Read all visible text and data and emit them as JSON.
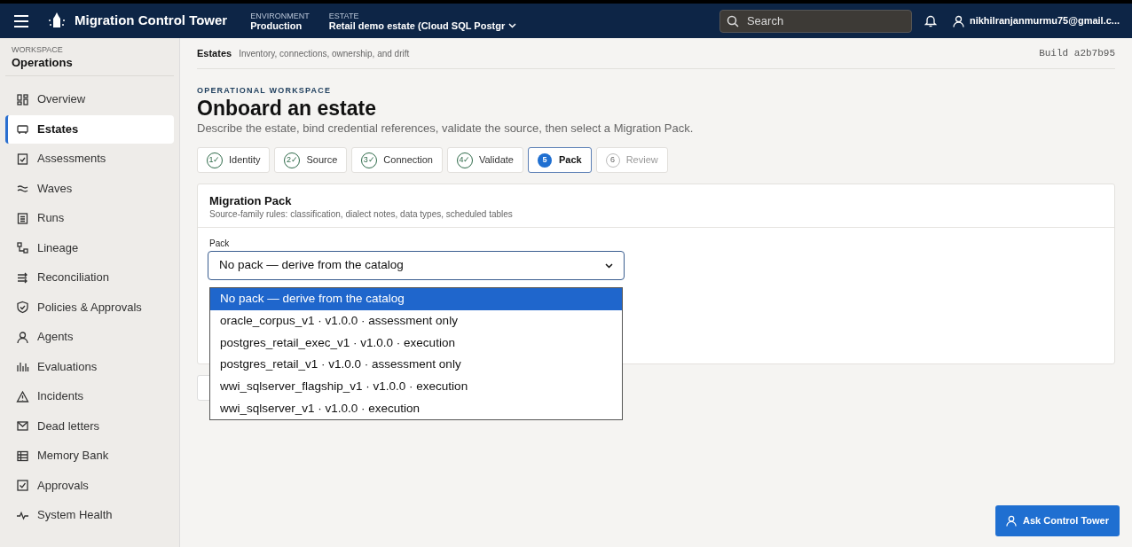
{
  "topbar": {
    "title": "Migration Control Tower",
    "environment": {
      "label": "ENVIRONMENT",
      "value": "Production"
    },
    "estate": {
      "label": "ESTATE",
      "value": "Retail demo estate (Cloud SQL Postgr"
    },
    "search": {
      "placeholder": "Search"
    },
    "user": "nikhilranjanmurmu75@gmail.c..."
  },
  "sidebar": {
    "workspace_label": "WORKSPACE",
    "workspace": "Operations",
    "items": [
      {
        "label": "Overview",
        "selected": false
      },
      {
        "label": "Estates",
        "selected": true
      },
      {
        "label": "Assessments",
        "selected": false
      },
      {
        "label": "Waves",
        "selected": false
      },
      {
        "label": "Runs",
        "selected": false
      },
      {
        "label": "Lineage",
        "selected": false
      },
      {
        "label": "Reconciliation",
        "selected": false
      },
      {
        "label": "Policies & Approvals",
        "selected": false
      },
      {
        "label": "Agents",
        "selected": false
      },
      {
        "label": "Evaluations",
        "selected": false
      },
      {
        "label": "Incidents",
        "selected": false
      },
      {
        "label": "Dead letters",
        "selected": false
      },
      {
        "label": "Memory Bank",
        "selected": false
      },
      {
        "label": "Approvals",
        "selected": false
      },
      {
        "label": "System Health",
        "selected": false
      }
    ]
  },
  "header": {
    "section": "Estates",
    "subtitle": "Inventory, connections, ownership, and drift",
    "build": "Build a2b7b95"
  },
  "page": {
    "eyebrow": "OPERATIONAL WORKSPACE",
    "title": "Onboard an estate",
    "description": "Describe the estate, bind credential references, validate the source, then select a Migration Pack."
  },
  "steps": [
    {
      "number": "1✓",
      "label": "Identity",
      "checked": true,
      "selected": false
    },
    {
      "number": "2✓",
      "label": "Source",
      "checked": true,
      "selected": false
    },
    {
      "number": "3✓",
      "label": "Connection",
      "checked": true,
      "selected": false
    },
    {
      "number": "4✓",
      "label": "Validate",
      "checked": true,
      "selected": false
    },
    {
      "number": "5",
      "label": "Pack",
      "checked": false,
      "selected": true
    },
    {
      "number": "6",
      "label": "Review",
      "checked": false,
      "selected": false
    }
  ],
  "card": {
    "title": "Migration Pack",
    "subtitle": "Source-family rules: classification, dialect notes, data types, scheduled tables",
    "field_label": "Pack",
    "value": "No pack — derive from the catalog",
    "options": [
      {
        "label": "No pack — derive from the catalog",
        "selected": true
      },
      {
        "label": "oracle_corpus_v1 · v1.0.0 · assessment only",
        "selected": false
      },
      {
        "label": "postgres_retail_exec_v1 · v1.0.0 · execution",
        "selected": false
      },
      {
        "label": "postgres_retail_v1 · v1.0.0 · assessment only",
        "selected": false
      },
      {
        "label": "wwi_sqlserver_flagship_v1 · v1.0.0 · execution",
        "selected": false
      },
      {
        "label": "wwi_sqlserver_v1 · v1.0.0 · execution",
        "selected": false
      }
    ]
  },
  "assistant_button": "Ask Control Tower"
}
